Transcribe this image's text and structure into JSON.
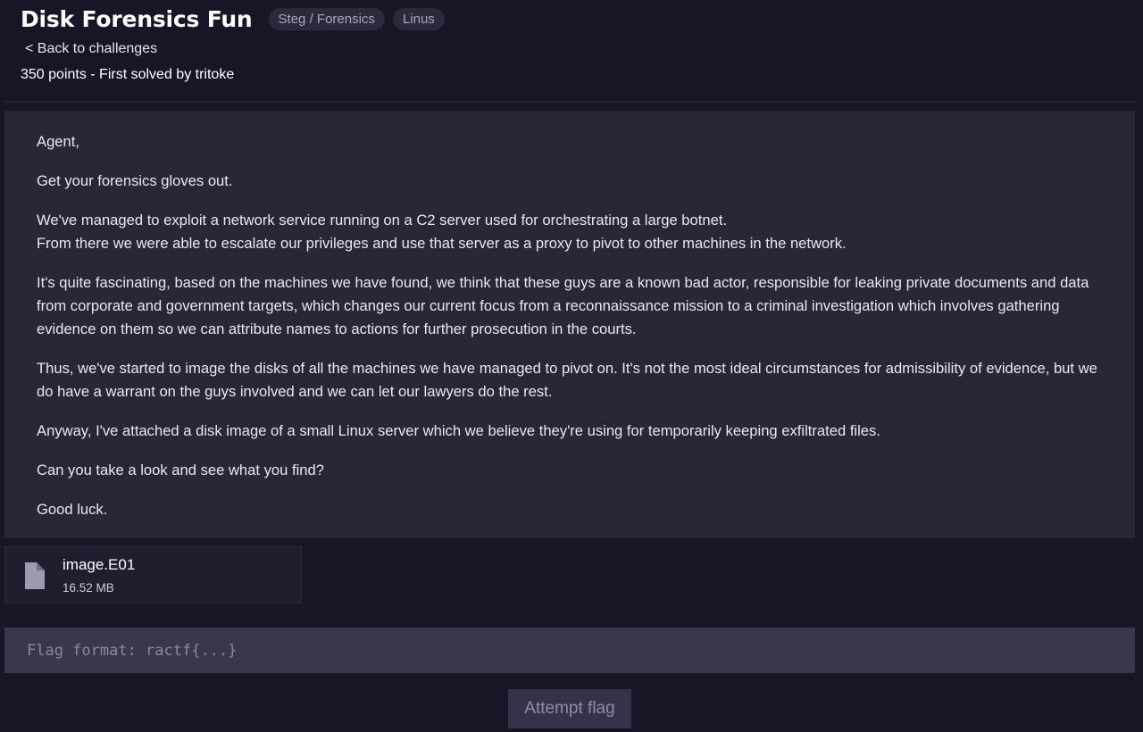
{
  "challenge": {
    "title": "Disk Forensics Fun",
    "tags": [
      "Steg / Forensics",
      "Linus"
    ],
    "back_link": "< Back to challenges",
    "meta": "350 points - First solved by tritoke"
  },
  "description": {
    "paragraphs": [
      "Agent,",
      "Get your forensics gloves out.",
      "We've managed to exploit a network service running on a C2 server used for orchestrating a large botnet.\nFrom there we were able to escalate our privileges and use that server as a proxy to pivot to other machines in the network.",
      "It's quite fascinating, based on the machines we have found, we think that these guys are a known bad actor, responsible for leaking private documents and data from corporate and government targets, which changes our current focus from a reconnaissance mission to a criminal investigation which involves gathering evidence on them so we can attribute names to actions for further prosecution in the courts.",
      "Thus, we've started to image the disks of all the machines we have managed to pivot on. It's not the most ideal circumstances for admissibility of evidence, but we do have a warrant on the guys involved and we can let our lawyers do the rest.",
      "Anyway, I've attached a disk image of a small Linux server which we believe they're using for temporarily keeping exfiltrated files.",
      "Can you take a look and see what you find?",
      "Good luck."
    ]
  },
  "file": {
    "icon": "file-icon",
    "name": "image.E01",
    "size": "16.52 MB"
  },
  "flag": {
    "placeholder": "Flag format: ractf{...}",
    "value": "",
    "submit_label": "Attempt flag"
  },
  "colors": {
    "background": "#181626",
    "panel": "#282738",
    "input": "#39374c",
    "tag": "#2b293c"
  }
}
